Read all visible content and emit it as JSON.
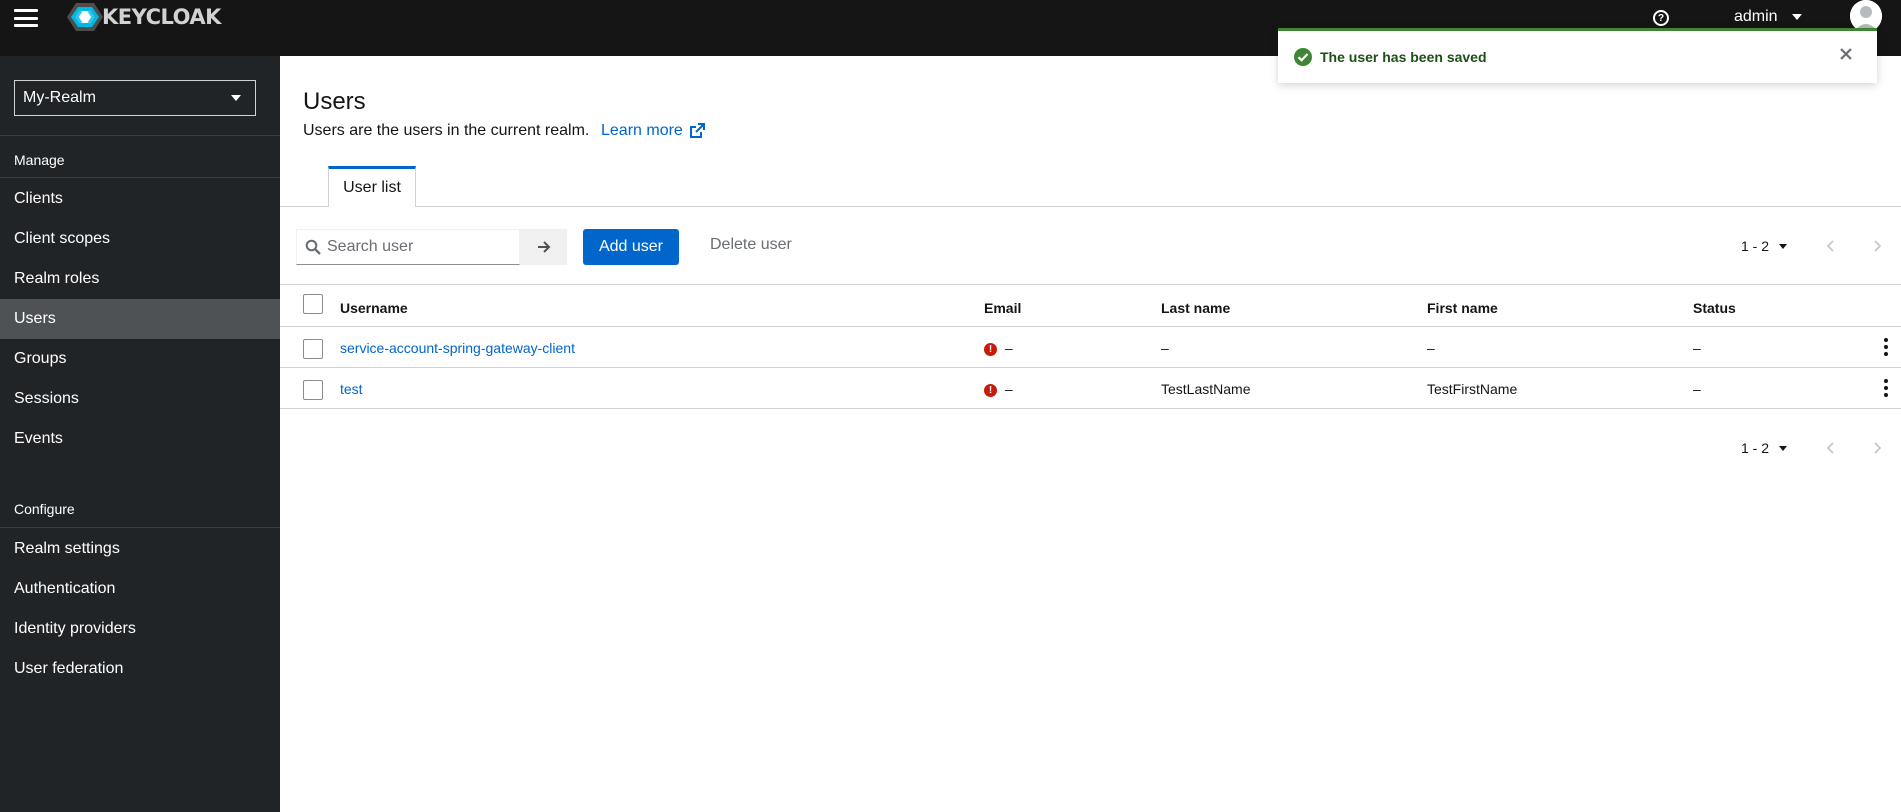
{
  "header": {
    "logo_text": "KEYCLOAK",
    "help_glyph": "?",
    "username": "admin"
  },
  "sidebar": {
    "realm": "My-Realm",
    "manage_label": "Manage",
    "manage_items": [
      {
        "label": "Clients"
      },
      {
        "label": "Client scopes"
      },
      {
        "label": "Realm roles"
      },
      {
        "label": "Users",
        "active": true
      },
      {
        "label": "Groups"
      },
      {
        "label": "Sessions"
      },
      {
        "label": "Events"
      }
    ],
    "configure_label": "Configure",
    "configure_items": [
      {
        "label": "Realm settings"
      },
      {
        "label": "Authentication"
      },
      {
        "label": "Identity providers"
      },
      {
        "label": "User federation"
      }
    ]
  },
  "main": {
    "title": "Users",
    "description": "Users are the users in the current realm.",
    "learn_more": "Learn more",
    "tabs": [
      {
        "label": "User list"
      }
    ],
    "toolbar": {
      "search_placeholder": "Search user",
      "add_user": "Add user",
      "delete_user": "Delete user",
      "pagination": "1 - 2"
    },
    "table": {
      "columns": [
        "Username",
        "Email",
        "Last name",
        "First name",
        "Status"
      ],
      "rows": [
        {
          "username": "service-account-spring-gateway-client",
          "email": "–",
          "last_name": "–",
          "first_name": "–",
          "status": "–",
          "email_warning": true
        },
        {
          "username": "test",
          "email": "–",
          "last_name": "TestLastName",
          "first_name": "TestFirstName",
          "status": "–",
          "email_warning": true
        }
      ]
    },
    "bottom_pagination": "1 - 2"
  },
  "toast": {
    "message": "The user has been saved",
    "variant": "success",
    "icon": "check-circle-icon"
  },
  "colors": {
    "header_bg": "#151515",
    "sidebar_bg": "#212427",
    "sidebar_active": "#4f5255",
    "primary": "#0066cc",
    "success": "#3e8635",
    "danger": "#c9190b"
  }
}
